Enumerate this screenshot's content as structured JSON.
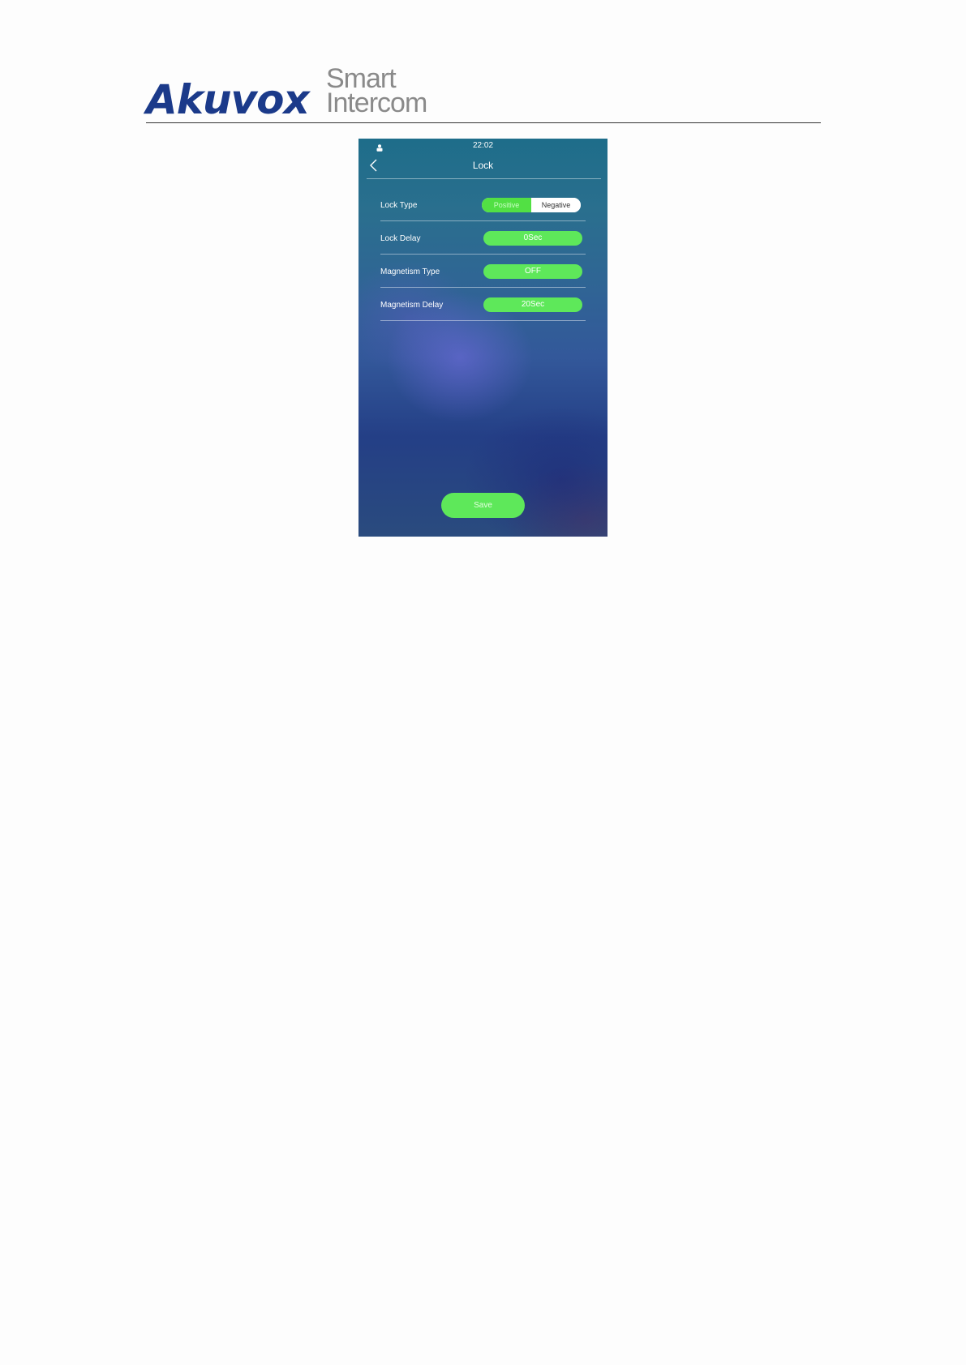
{
  "header": {
    "brand_name": "Akuvox",
    "brand_tagline_line1": "Smart",
    "brand_tagline_line2": "Intercom"
  },
  "status_bar": {
    "time": "22:02",
    "icon": "user-icon"
  },
  "nav": {
    "back_icon": "chevron-left-icon",
    "title": "Lock"
  },
  "settings": {
    "lock_type": {
      "label": "Lock Type",
      "options": [
        "Positive",
        "Negative"
      ],
      "selected": "Positive"
    },
    "lock_delay": {
      "label": "Lock Delay",
      "value": "0Sec"
    },
    "magnetism_type": {
      "label": "Magnetism Type",
      "value": "OFF"
    },
    "magnetism_delay": {
      "label": "Magnetism Delay",
      "value": "20Sec"
    }
  },
  "actions": {
    "save_label": "Save"
  },
  "colors": {
    "accent_green": "#5ee85a",
    "brand_blue": "#1b3a8a",
    "brand_gray": "#8a8a8a"
  }
}
